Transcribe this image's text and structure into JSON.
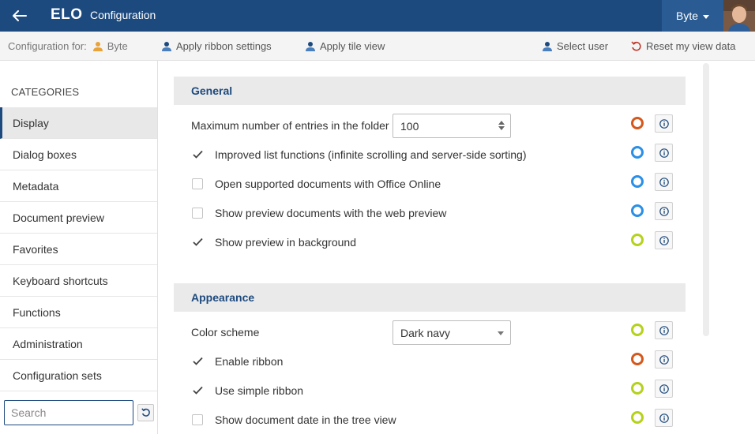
{
  "header": {
    "logo": "ELO",
    "title": "Configuration",
    "user": "Byte"
  },
  "toolbar": {
    "config_for_label": "Configuration for:",
    "config_for_user": "Byte",
    "apply_ribbon": "Apply ribbon settings",
    "apply_tile": "Apply tile view",
    "select_user": "Select user",
    "reset_view": "Reset my view data"
  },
  "sidebar": {
    "heading": "CATEGORIES",
    "items": [
      {
        "label": "Display",
        "active": true
      },
      {
        "label": "Dialog boxes"
      },
      {
        "label": "Metadata"
      },
      {
        "label": "Document preview"
      },
      {
        "label": "Favorites"
      },
      {
        "label": "Keyboard shortcuts"
      },
      {
        "label": "Functions"
      },
      {
        "label": "Administration"
      },
      {
        "label": "Configuration sets"
      }
    ],
    "search_placeholder": "Search"
  },
  "colors": {
    "navy": "#1d4a7e",
    "ring_orange": "#d4581c",
    "ring_blue": "#2a8fe6",
    "ring_green": "#b6d11c"
  },
  "general": {
    "title": "General",
    "max_entries_label": "Maximum number of entries in the folder",
    "max_entries_value": "100",
    "improved_list": "Improved list functions (infinite scrolling and server-side sorting)",
    "office_online": "Open supported documents with Office Online",
    "web_preview": "Show preview documents with the web preview",
    "preview_background": "Show preview in background"
  },
  "appearance": {
    "title": "Appearance",
    "color_scheme_label": "Color scheme",
    "color_scheme_value": "Dark navy",
    "enable_ribbon": "Enable ribbon",
    "simple_ribbon": "Use simple ribbon",
    "doc_date_tree": "Show document date in the tree view"
  }
}
